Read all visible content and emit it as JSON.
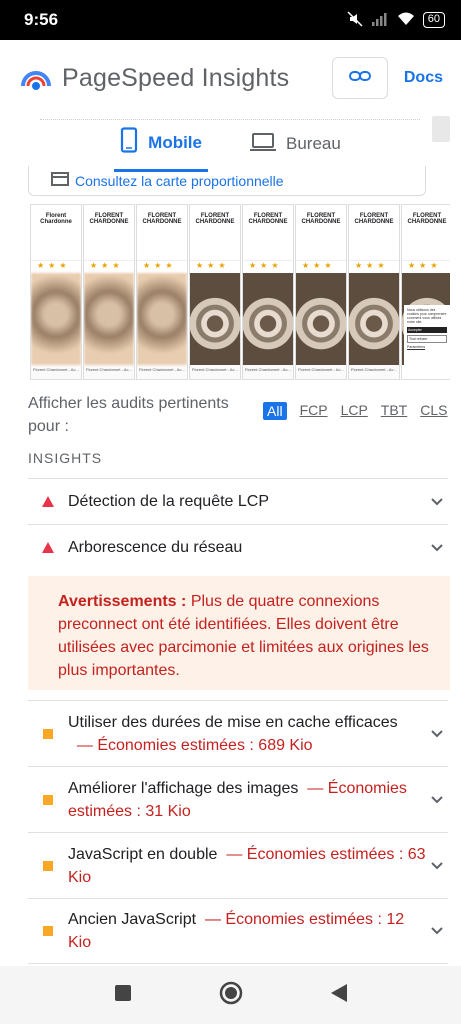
{
  "status": {
    "time": "9:56",
    "battery": "60"
  },
  "app": {
    "title": "PageSpeed Insights",
    "docs_label": "Docs"
  },
  "tabs": [
    {
      "label": "Mobile"
    },
    {
      "label": "Bureau"
    }
  ],
  "map_link": "Consultez la carte proportionnelle",
  "filmstrip": {
    "frame_header": "FLORENT CHARDONNE",
    "frame_sub": "Praticien Bien-Êt",
    "first_header": "Florent Chardonne",
    "hero_text": "Au Cœur de",
    "foot_text": "Florent Chardonnet - Ac...",
    "consent_text": "Nous utilisons des cookies pour comprendre comment vous utilisez notre site.",
    "consent_accept": "Accepter",
    "consent_refuse": "Tout refuser",
    "consent_params": "Paramètres"
  },
  "filter": {
    "label": "Afficher les audits pertinents pour :",
    "chips": [
      "All",
      "FCP",
      "LCP",
      "TBT",
      "CLS"
    ]
  },
  "insights_header": "INSIGHTS",
  "audits_red": [
    {
      "label": "Détection de la requête LCP"
    },
    {
      "label": "Arborescence du réseau"
    }
  ],
  "warning": {
    "title": "Avertissements :",
    "text": "Plus de quatre connexions preconnect ont été identifiées. Elles doivent être utilisées avec parcimonie et limitées aux origines les plus importantes."
  },
  "audits_orange": [
    {
      "label": "Utiliser des durées de mise en cache efficaces",
      "savings": "— Économies estimées : 689 Kio"
    },
    {
      "label": "Améliorer l'affichage des images",
      "savings": "— Économies estimées : 31 Kio"
    },
    {
      "label": "JavaScript en double",
      "savings": "— Économies estimées : 63 Kio"
    },
    {
      "label": "Ancien JavaScript",
      "savings": "— Économies estimées : 12 Kio"
    }
  ],
  "colors": {
    "accent": "#1a73e8",
    "fail": "#e8334a",
    "average": "#f9a825",
    "savings": "#c5221f",
    "warning_bg": "#fdf1e8"
  }
}
